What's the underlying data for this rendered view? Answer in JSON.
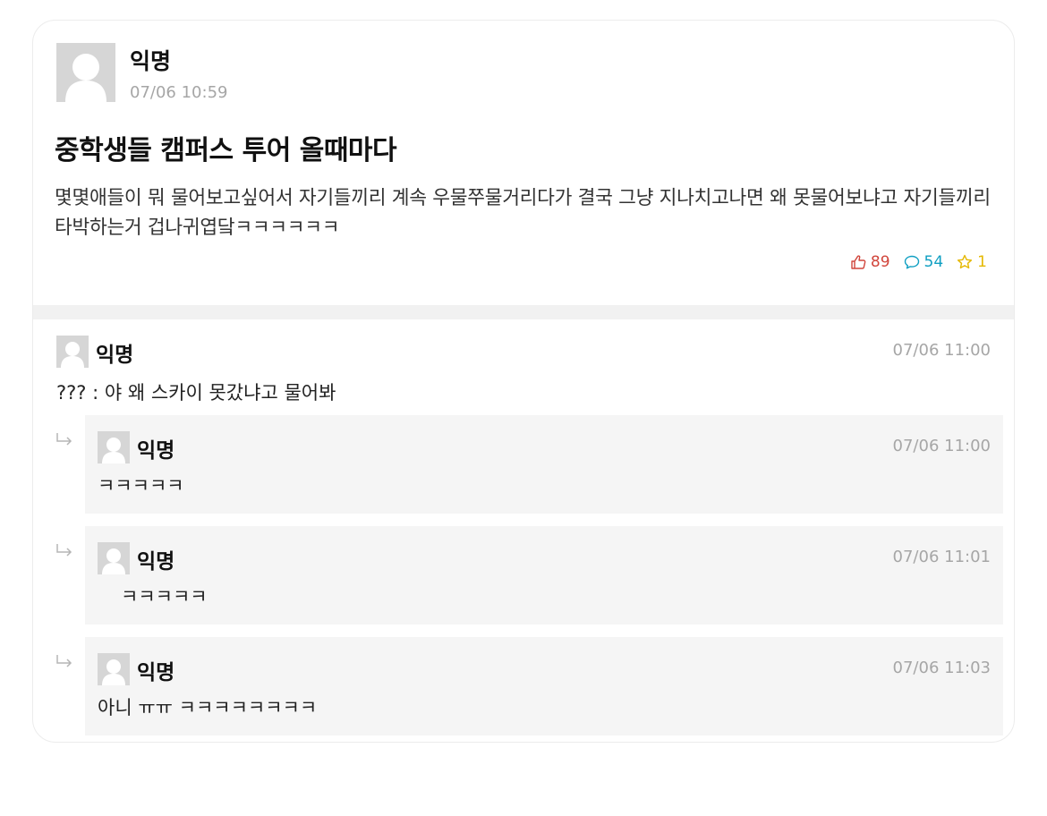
{
  "post": {
    "author": "익명",
    "time": "07/06 10:59",
    "title": "중학생들 캠퍼스 투어 올때마다",
    "body": "몇몇애들이 뭐 물어보고싶어서 자기들끼리 계속 우물쭈물거리다가 결국 그냥 지나치고나면 왜 못물어보냐고 자기들끼리 타박하는거 겁나귀엽닼ㅋㅋㅋㅋㅋㅋ",
    "stats": {
      "likes": "89",
      "comments": "54",
      "scraps": "1",
      "like_icon": "thumbs-up-icon",
      "comment_icon": "speech-bubble-icon",
      "scrap_icon": "star-icon",
      "like_color": "#d1453b",
      "comment_color": "#0f9fc2",
      "scrap_color": "#e5b800"
    }
  },
  "comments": [
    {
      "author": "익명",
      "time": "07/06 11:00",
      "text": "??? : 야 왜 스카이 못갔냐고 물어봐",
      "replies": [
        {
          "author": "익명",
          "time": "07/06 11:00",
          "text": "ㅋㅋㅋㅋㅋ"
        },
        {
          "author": "익명",
          "time": "07/06 11:01",
          "text": "ㅋㅋㅋㅋㅋ"
        },
        {
          "author": "익명",
          "time": "07/06 11:03",
          "text": "아니 ㅠㅠ ㅋㅋㅋㅋㅋㅋㅋㅋ"
        }
      ]
    }
  ]
}
